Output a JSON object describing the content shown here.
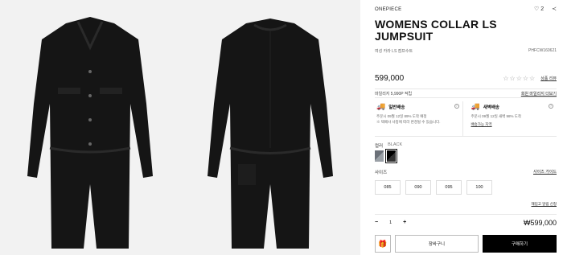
{
  "product": {
    "brand": "ONEPIECE",
    "title": "WOMENS COLLAR LS JUMPSUIT",
    "subtitle_kr": "여성 카라 LS 점프수트",
    "code": "PHFCW160621",
    "price": "599,000",
    "rating_stars": "☆☆☆☆☆",
    "review_link": "상품 리뷰",
    "wish_count": "2"
  },
  "points": {
    "text": "마일리지 5,990P 적립",
    "link": "회원 마일리지 더보기"
  },
  "shipping": {
    "standard": {
      "title": "일반배송",
      "desc1": "주문시 09월 12일 89% 도착 예정",
      "desc2": "※ 택배사 사정에 따라 변경될 수 있습니다."
    },
    "dawn": {
      "title": "새벽배송",
      "desc1": "주문시 09월 12일 새벽 98% 도착",
      "link": "배송가능 지역"
    }
  },
  "color": {
    "label": "컬러",
    "value": "BLACK",
    "swatches": [
      "grey",
      "black"
    ]
  },
  "size": {
    "label": "사이즈",
    "guide": "사이즈 가이드",
    "options": [
      "085",
      "090",
      "095",
      "100"
    ],
    "restock": "재입고 알림 신청"
  },
  "quantity": {
    "minus": "−",
    "value": "1",
    "plus": "+",
    "total": "₩599,000"
  },
  "actions": {
    "gift_icon": "gift-icon",
    "cart": "장바구니",
    "buy": "구매하기"
  },
  "icons": {
    "heart": "♡",
    "share": "≺",
    "gift": "🎁",
    "truck": "🚚"
  }
}
